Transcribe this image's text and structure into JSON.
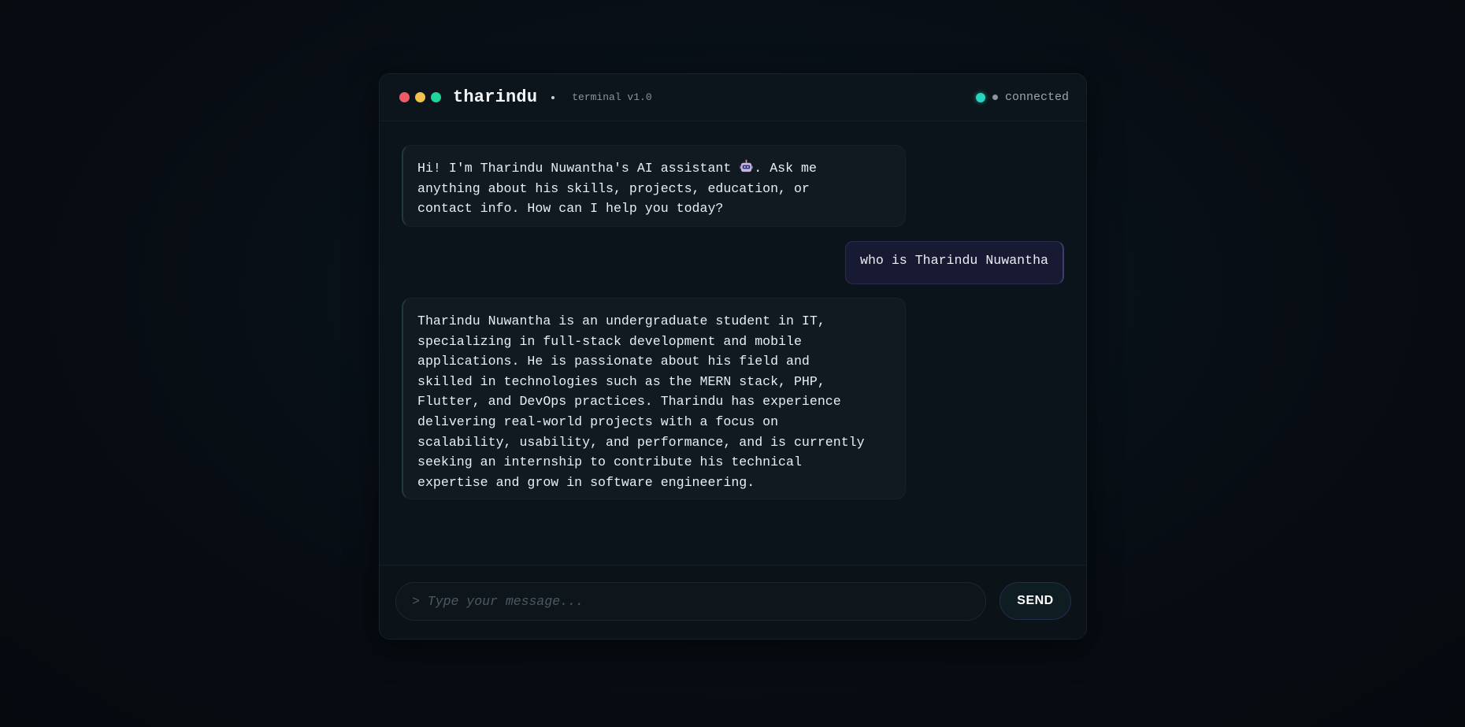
{
  "titlebar": {
    "app_title": "tharindu",
    "separator": "·",
    "version": "terminal v1.0",
    "status_label": "connected",
    "dot_colors": {
      "close": "#ef5b62",
      "minimize": "#f2c04d",
      "maximize": "#22d39a"
    },
    "status_color": "#27d6c0"
  },
  "messages": [
    {
      "role": "assistant",
      "text_before_icon": "Hi! I'm Tharindu Nuwantha's AI assistant ",
      "icon": "robot-icon",
      "text_after_icon": ". Ask me\nanything about his skills, projects, education, or\ncontact info. How can I help you today?"
    },
    {
      "role": "user",
      "text": "who is Tharindu Nuwantha"
    },
    {
      "role": "assistant",
      "text": "Tharindu Nuwantha is an undergraduate student in IT,\nspecializing in full-stack development and mobile\napplications. He is passionate about his field and\nskilled in technologies such as the MERN stack, PHP,\nFlutter, and DevOps practices. Tharindu has experience\ndelivering real-world projects with a focus on\nscalability, usability, and performance, and is currently\nseeking an internship to contribute his technical\nexpertise and grow in software engineering."
    }
  ],
  "composer": {
    "placeholder": "> Type your message...",
    "value": "",
    "send_label": "SEND"
  }
}
